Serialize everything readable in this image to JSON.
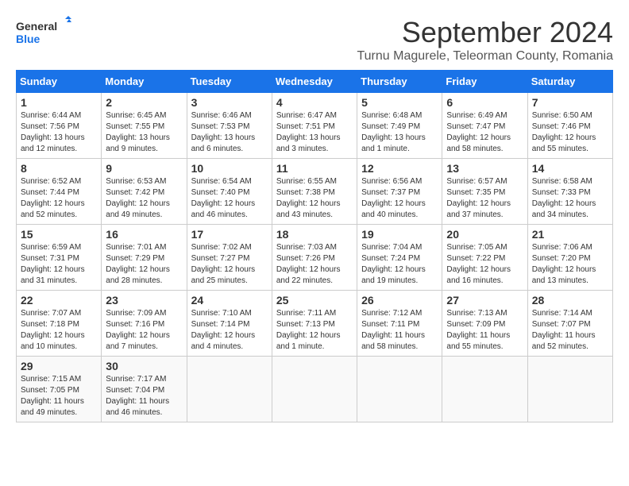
{
  "app": {
    "logo_line1": "General",
    "logo_line2": "Blue"
  },
  "header": {
    "month_year": "September 2024",
    "location": "Turnu Magurele, Teleorman County, Romania"
  },
  "days_of_week": [
    "Sunday",
    "Monday",
    "Tuesday",
    "Wednesday",
    "Thursday",
    "Friday",
    "Saturday"
  ],
  "weeks": [
    [
      {
        "day": "1",
        "info": "Sunrise: 6:44 AM\nSunset: 7:56 PM\nDaylight: 13 hours\nand 12 minutes."
      },
      {
        "day": "2",
        "info": "Sunrise: 6:45 AM\nSunset: 7:55 PM\nDaylight: 13 hours\nand 9 minutes."
      },
      {
        "day": "3",
        "info": "Sunrise: 6:46 AM\nSunset: 7:53 PM\nDaylight: 13 hours\nand 6 minutes."
      },
      {
        "day": "4",
        "info": "Sunrise: 6:47 AM\nSunset: 7:51 PM\nDaylight: 13 hours\nand 3 minutes."
      },
      {
        "day": "5",
        "info": "Sunrise: 6:48 AM\nSunset: 7:49 PM\nDaylight: 13 hours\nand 1 minute."
      },
      {
        "day": "6",
        "info": "Sunrise: 6:49 AM\nSunset: 7:47 PM\nDaylight: 12 hours\nand 58 minutes."
      },
      {
        "day": "7",
        "info": "Sunrise: 6:50 AM\nSunset: 7:46 PM\nDaylight: 12 hours\nand 55 minutes."
      }
    ],
    [
      {
        "day": "8",
        "info": "Sunrise: 6:52 AM\nSunset: 7:44 PM\nDaylight: 12 hours\nand 52 minutes."
      },
      {
        "day": "9",
        "info": "Sunrise: 6:53 AM\nSunset: 7:42 PM\nDaylight: 12 hours\nand 49 minutes."
      },
      {
        "day": "10",
        "info": "Sunrise: 6:54 AM\nSunset: 7:40 PM\nDaylight: 12 hours\nand 46 minutes."
      },
      {
        "day": "11",
        "info": "Sunrise: 6:55 AM\nSunset: 7:38 PM\nDaylight: 12 hours\nand 43 minutes."
      },
      {
        "day": "12",
        "info": "Sunrise: 6:56 AM\nSunset: 7:37 PM\nDaylight: 12 hours\nand 40 minutes."
      },
      {
        "day": "13",
        "info": "Sunrise: 6:57 AM\nSunset: 7:35 PM\nDaylight: 12 hours\nand 37 minutes."
      },
      {
        "day": "14",
        "info": "Sunrise: 6:58 AM\nSunset: 7:33 PM\nDaylight: 12 hours\nand 34 minutes."
      }
    ],
    [
      {
        "day": "15",
        "info": "Sunrise: 6:59 AM\nSunset: 7:31 PM\nDaylight: 12 hours\nand 31 minutes."
      },
      {
        "day": "16",
        "info": "Sunrise: 7:01 AM\nSunset: 7:29 PM\nDaylight: 12 hours\nand 28 minutes."
      },
      {
        "day": "17",
        "info": "Sunrise: 7:02 AM\nSunset: 7:27 PM\nDaylight: 12 hours\nand 25 minutes."
      },
      {
        "day": "18",
        "info": "Sunrise: 7:03 AM\nSunset: 7:26 PM\nDaylight: 12 hours\nand 22 minutes."
      },
      {
        "day": "19",
        "info": "Sunrise: 7:04 AM\nSunset: 7:24 PM\nDaylight: 12 hours\nand 19 minutes."
      },
      {
        "day": "20",
        "info": "Sunrise: 7:05 AM\nSunset: 7:22 PM\nDaylight: 12 hours\nand 16 minutes."
      },
      {
        "day": "21",
        "info": "Sunrise: 7:06 AM\nSunset: 7:20 PM\nDaylight: 12 hours\nand 13 minutes."
      }
    ],
    [
      {
        "day": "22",
        "info": "Sunrise: 7:07 AM\nSunset: 7:18 PM\nDaylight: 12 hours\nand 10 minutes."
      },
      {
        "day": "23",
        "info": "Sunrise: 7:09 AM\nSunset: 7:16 PM\nDaylight: 12 hours\nand 7 minutes."
      },
      {
        "day": "24",
        "info": "Sunrise: 7:10 AM\nSunset: 7:14 PM\nDaylight: 12 hours\nand 4 minutes."
      },
      {
        "day": "25",
        "info": "Sunrise: 7:11 AM\nSunset: 7:13 PM\nDaylight: 12 hours\nand 1 minute."
      },
      {
        "day": "26",
        "info": "Sunrise: 7:12 AM\nSunset: 7:11 PM\nDaylight: 11 hours\nand 58 minutes."
      },
      {
        "day": "27",
        "info": "Sunrise: 7:13 AM\nSunset: 7:09 PM\nDaylight: 11 hours\nand 55 minutes."
      },
      {
        "day": "28",
        "info": "Sunrise: 7:14 AM\nSunset: 7:07 PM\nDaylight: 11 hours\nand 52 minutes."
      }
    ],
    [
      {
        "day": "29",
        "info": "Sunrise: 7:15 AM\nSunset: 7:05 PM\nDaylight: 11 hours\nand 49 minutes."
      },
      {
        "day": "30",
        "info": "Sunrise: 7:17 AM\nSunset: 7:04 PM\nDaylight: 11 hours\nand 46 minutes."
      },
      {
        "day": "",
        "info": ""
      },
      {
        "day": "",
        "info": ""
      },
      {
        "day": "",
        "info": ""
      },
      {
        "day": "",
        "info": ""
      },
      {
        "day": "",
        "info": ""
      }
    ]
  ]
}
